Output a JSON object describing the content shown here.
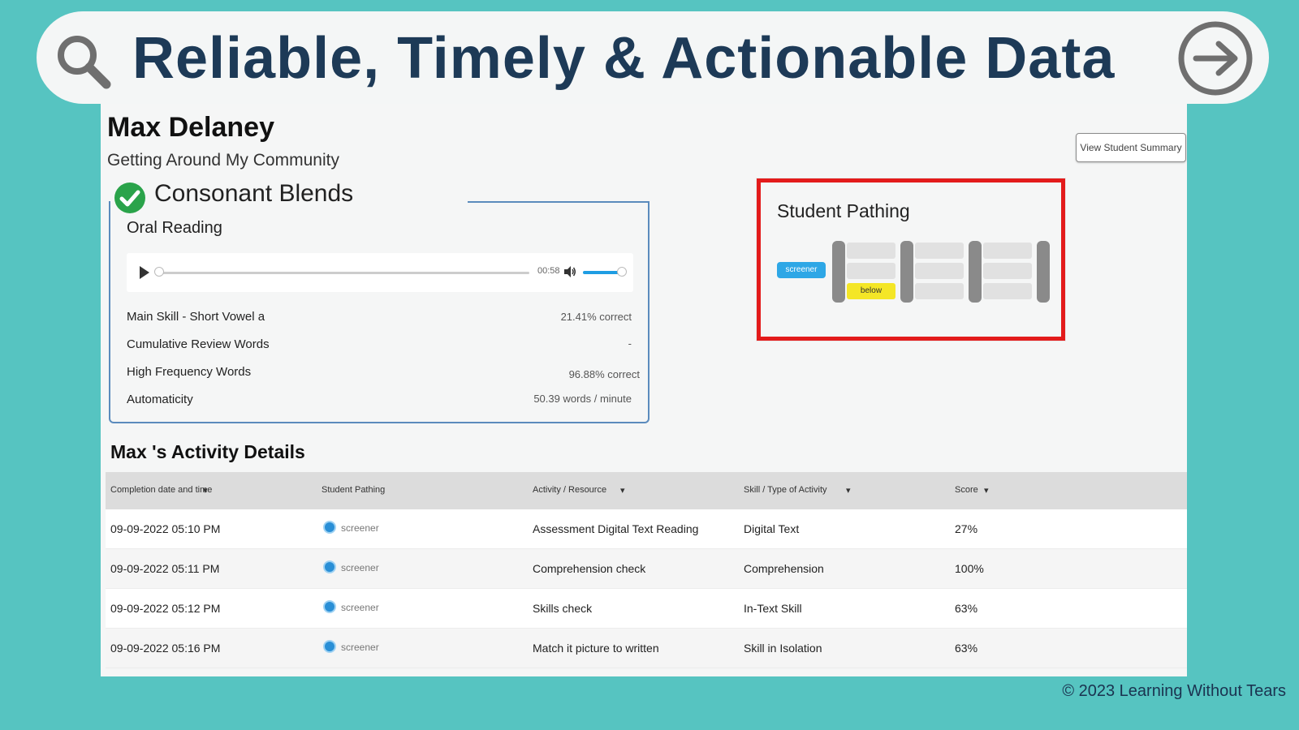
{
  "banner": {
    "title": "Reliable, Timely & Actionable Data",
    "search_icon": "search-icon",
    "arrow_icon": "arrow-right-circle-icon"
  },
  "student": {
    "name": "Max Delaney",
    "unit": "Getting Around My Community",
    "summary_button": "View Student Summary"
  },
  "lesson": {
    "title": "Consonant Blends",
    "status_icon": "check-circle-icon",
    "section": "Oral Reading",
    "player": {
      "time": "00:58",
      "progress": 0.0,
      "volume": 0.9
    },
    "metrics": [
      {
        "label": "Main Skill - Short Vowel a",
        "value": "21.41% correct"
      },
      {
        "label": "Cumulative Review Words",
        "value": "-"
      },
      {
        "label": "High Frequency Words",
        "value": "96.88% correct"
      },
      {
        "label": "Automaticity",
        "value": "50.39 words / minute"
      }
    ]
  },
  "pathing": {
    "title": "Student Pathing",
    "screener": "screener",
    "below": "below"
  },
  "activity": {
    "title": "Max 's Activity Details",
    "headers": [
      "Completion date and time",
      "Student Pathing",
      "Activity / Resource",
      "Skill / Type of Activity",
      "Score"
    ],
    "rows": [
      {
        "date": "09-09-2022 05:10 PM",
        "path": "screener",
        "activity": "Assessment Digital Text Reading",
        "skill": "Digital Text",
        "score": "27%"
      },
      {
        "date": "09-09-2022 05:11 PM",
        "path": "screener",
        "activity": "Comprehension check",
        "skill": "Comprehension",
        "score": "100%"
      },
      {
        "date": "09-09-2022 05:12 PM",
        "path": "screener",
        "activity": "Skills check",
        "skill": "In-Text Skill",
        "score": "63%"
      },
      {
        "date": "09-09-2022 05:16 PM",
        "path": "screener",
        "activity": "Match it picture to written",
        "skill": "Skill in Isolation",
        "score": "63%"
      }
    ]
  },
  "footer": {
    "copyright": "© 2023 Learning Without Tears"
  },
  "colors": {
    "background": "#56c4c1",
    "title": "#1d3a57",
    "highlight_border": "#e31b1b",
    "screener_tag": "#2ea7e6",
    "below_tag": "#f4e627",
    "card_border": "#5b8bbd"
  }
}
